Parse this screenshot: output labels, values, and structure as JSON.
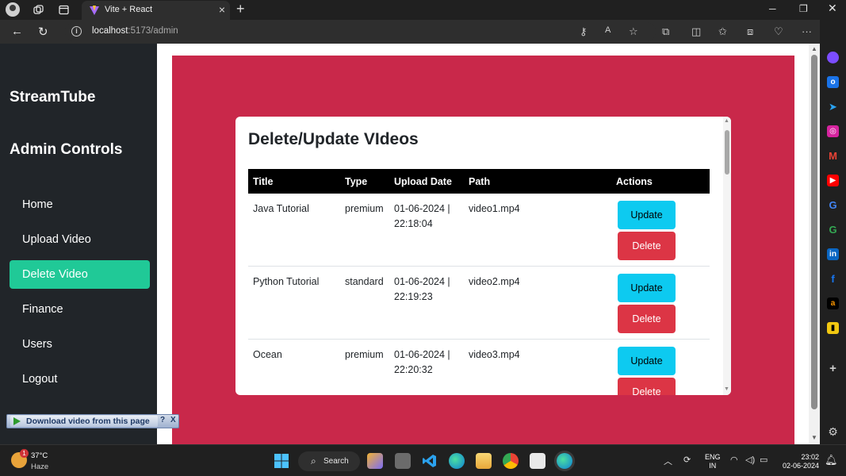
{
  "browser": {
    "tab_title": "Vite + React",
    "url_host": "localhost",
    "url_path": ":5173/admin"
  },
  "sidebar": {
    "brand": "StreamTube",
    "section_title": "Admin Controls",
    "items": [
      {
        "label": "Home",
        "active": false
      },
      {
        "label": "Upload Video",
        "active": false
      },
      {
        "label": "Delete Video",
        "active": true
      },
      {
        "label": "Finance",
        "active": false
      },
      {
        "label": "Users",
        "active": false
      },
      {
        "label": "Logout",
        "active": false
      }
    ]
  },
  "main": {
    "title": "Delete/Update VIdeos",
    "columns": [
      "Title",
      "Type",
      "Upload Date",
      "Path",
      "Actions"
    ],
    "rows": [
      {
        "title": "Java Tutorial",
        "type": "premium",
        "date_line1": "01-06-2024 |",
        "date_line2": "22:18:04",
        "path": "video1.mp4",
        "update_label": "Update",
        "delete_label": "Delete"
      },
      {
        "title": "Python Tutorial",
        "type": "standard",
        "date_line1": "01-06-2024 |",
        "date_line2": "22:19:23",
        "path": "video2.mp4",
        "update_label": "Update",
        "delete_label": "Delete"
      },
      {
        "title": "Ocean",
        "type": "premium",
        "date_line1": "01-06-2024 |",
        "date_line2": "22:20:32",
        "path": "video3.mp4",
        "update_label": "Update",
        "delete_label": "Delete"
      }
    ]
  },
  "download_bar": {
    "label": "Download video from this page",
    "help": "?",
    "close": "X"
  },
  "taskbar": {
    "weather_temp": "37°C",
    "weather_cond": "Haze",
    "weather_badge": "1",
    "search_label": "Search",
    "lang_line1": "ENG",
    "lang_line2": "IN",
    "time": "23:02",
    "date": "02-06-2024"
  },
  "colors": {
    "sidebar_bg": "#212529",
    "active_nav": "#20c997",
    "main_bg": "#c9284a",
    "update_btn": "#0dcaf0",
    "delete_btn": "#dc3545"
  }
}
